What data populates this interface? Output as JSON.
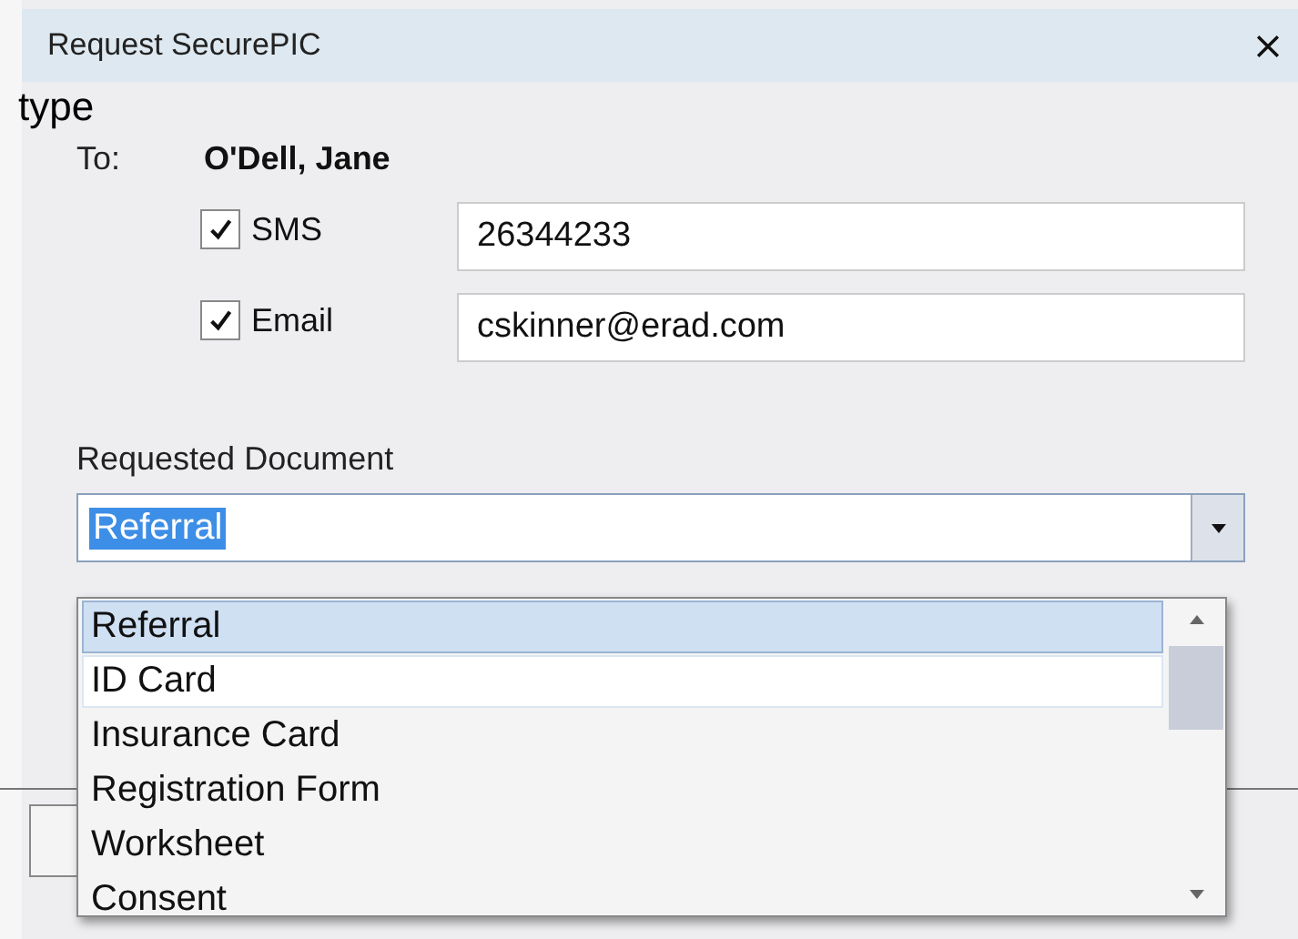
{
  "overlay_label": "type",
  "window": {
    "title": "Request SecurePIC"
  },
  "recipient": {
    "label": "To:",
    "name": "O'Dell, Jane"
  },
  "channels": [
    {
      "label": "SMS",
      "checked": true,
      "value": "26344233"
    },
    {
      "label": "Email",
      "checked": true,
      "value": "cskinner@erad.com"
    }
  ],
  "document": {
    "label": "Requested Document",
    "value": "Referral",
    "options": [
      {
        "label": "Referral",
        "selected": true,
        "hovered": false
      },
      {
        "label": "ID Card",
        "selected": false,
        "hovered": true
      },
      {
        "label": "Insurance Card",
        "selected": false,
        "hovered": false
      },
      {
        "label": "Registration Form",
        "selected": false,
        "hovered": false
      },
      {
        "label": "Worksheet",
        "selected": false,
        "hovered": false
      },
      {
        "label": "Consent",
        "selected": false,
        "hovered": false
      }
    ]
  }
}
